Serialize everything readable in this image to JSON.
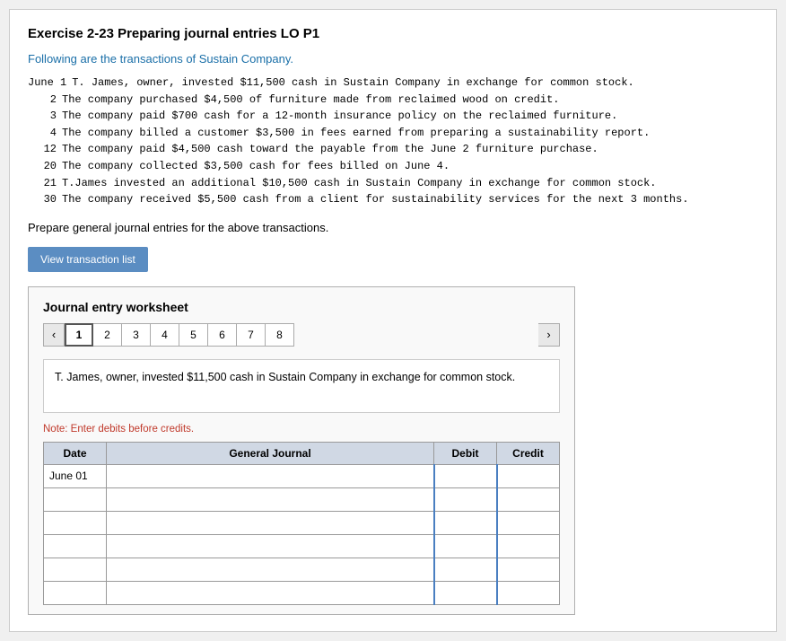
{
  "title": "Exercise 2-23 Preparing journal entries LO P1",
  "intro": "Following are the transactions of Sustain Company.",
  "transactions": [
    {
      "num": "June 1",
      "text": "T. James, owner, invested $11,500 cash in Sustain Company in exchange for common stock."
    },
    {
      "num": "2",
      "text": "The company purchased $4,500 of furniture made from reclaimed wood on credit."
    },
    {
      "num": "3",
      "text": "The company paid $700 cash for a 12-month insurance policy on the reclaimed furniture."
    },
    {
      "num": "4",
      "text": "The company billed a customer $3,500 in fees earned from preparing a sustainability report."
    },
    {
      "num": "12",
      "text": "The company paid $4,500 cash toward the payable from the June 2 furniture purchase."
    },
    {
      "num": "20",
      "text": "The company collected $3,500 cash for fees billed on June 4."
    },
    {
      "num": "21",
      "text": "T.James invested an additional $10,500 cash in Sustain Company in exchange for common stock."
    },
    {
      "num": "30",
      "text": "The company received $5,500 cash from a client for sustainability services for the next 3 months."
    }
  ],
  "prepare_text": "Prepare general journal entries for the above transactions.",
  "btn_view_label": "View transaction list",
  "worksheet": {
    "title": "Journal entry worksheet",
    "tabs": [
      "1",
      "2",
      "3",
      "4",
      "5",
      "6",
      "7",
      "8"
    ],
    "active_tab": "1",
    "transaction_desc": "T. James, owner, invested $11,500 cash in Sustain Company in exchange for\ncommon stock.",
    "note": "Note: Enter debits before credits.",
    "table": {
      "headers": [
        "Date",
        "General Journal",
        "Debit",
        "Credit"
      ],
      "rows": [
        {
          "date": "June 01",
          "journal": "",
          "debit": "",
          "credit": ""
        },
        {
          "date": "",
          "journal": "",
          "debit": "",
          "credit": ""
        },
        {
          "date": "",
          "journal": "",
          "debit": "",
          "credit": ""
        },
        {
          "date": "",
          "journal": "",
          "debit": "",
          "credit": ""
        },
        {
          "date": "",
          "journal": "",
          "debit": "",
          "credit": ""
        },
        {
          "date": "",
          "journal": "",
          "debit": "",
          "credit": ""
        }
      ]
    }
  }
}
